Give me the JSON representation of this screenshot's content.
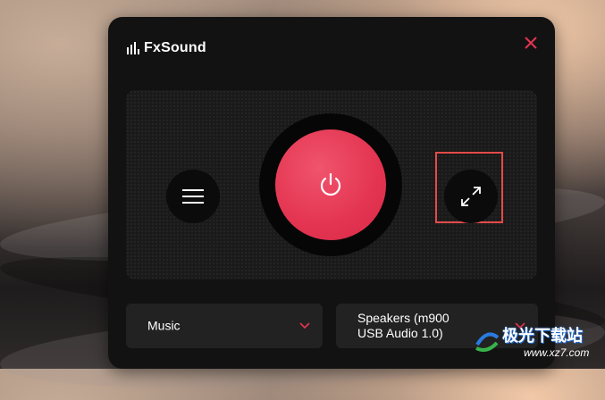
{
  "app": {
    "title": "FxSound",
    "brand_color": "#e33451",
    "close_icon": "close-icon"
  },
  "controls": {
    "menu_icon": "hamburger-menu-icon",
    "power_icon": "power-icon",
    "expand_icon": "expand-icon"
  },
  "dropdowns": {
    "preset": {
      "value": "Music",
      "icon": "chevron-down-icon"
    },
    "output": {
      "value": "Speakers (m900 USB Audio 1.0)",
      "icon": "chevron-down-icon"
    }
  },
  "watermark": {
    "text": "极光下载站",
    "url": "www.xz7.com"
  }
}
